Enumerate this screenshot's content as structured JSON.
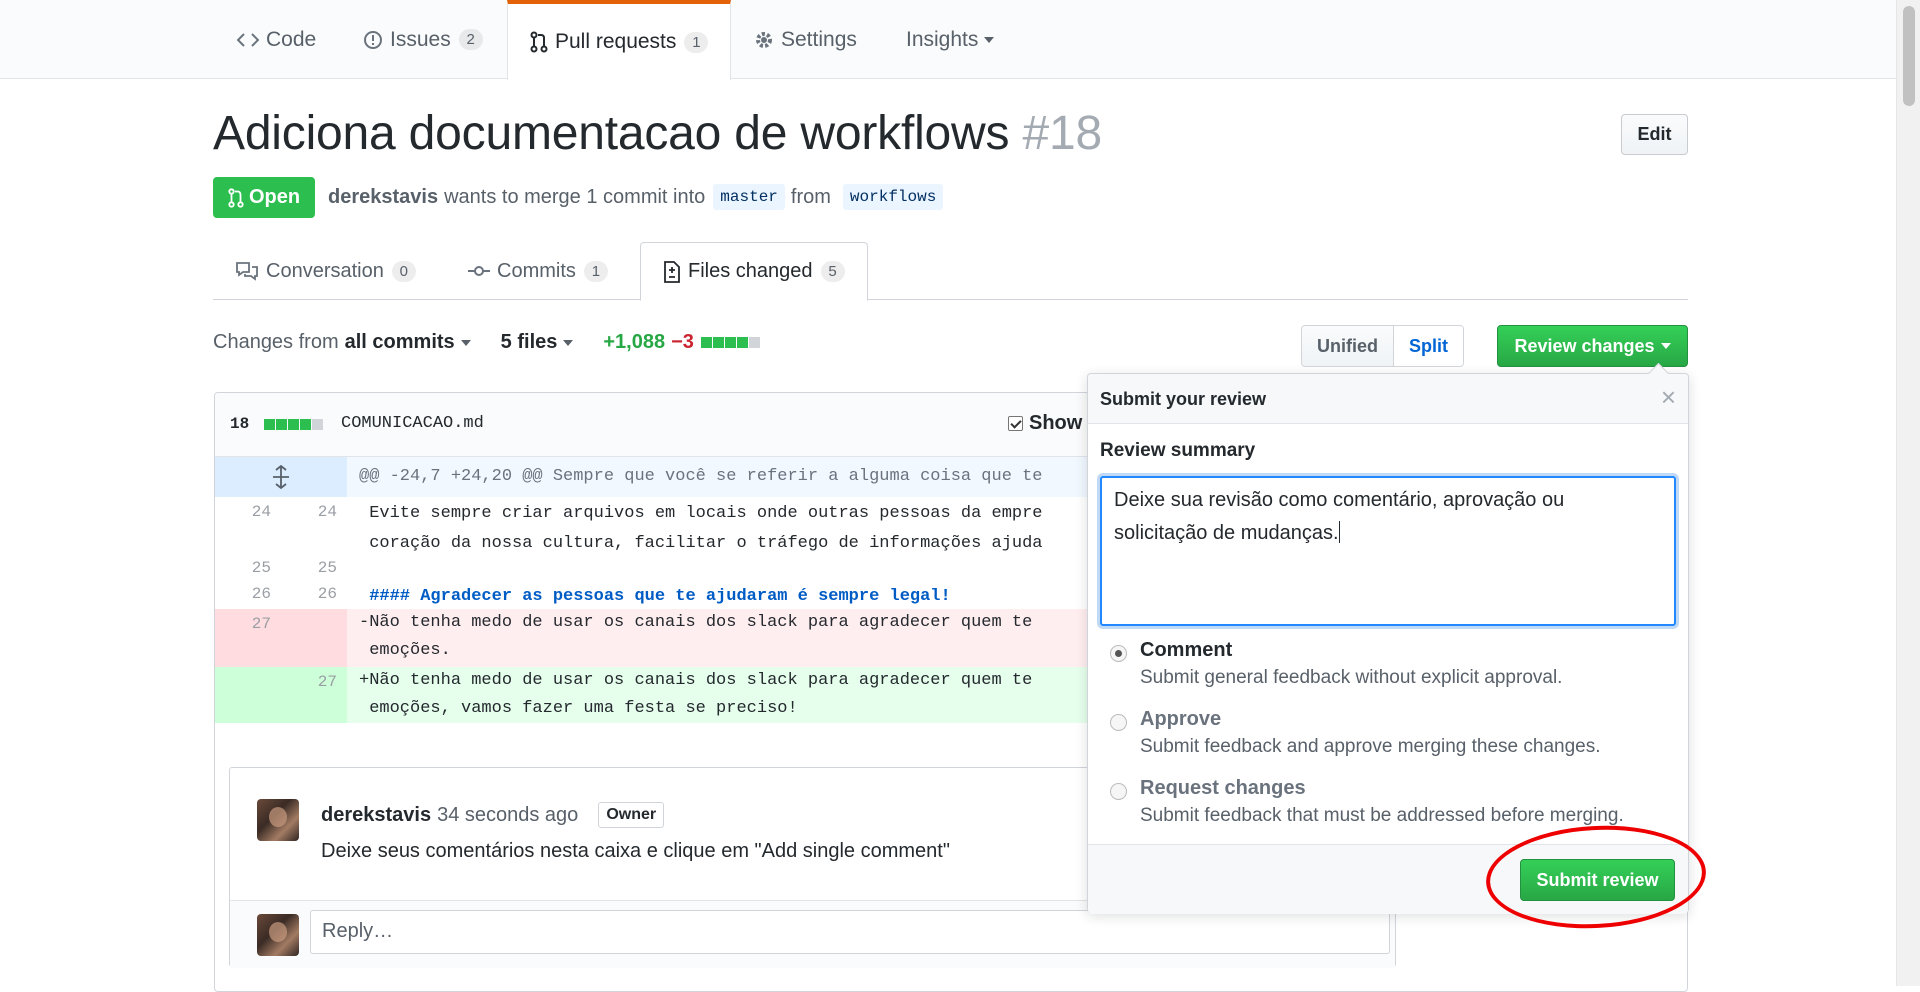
{
  "repo_nav": {
    "tabs": [
      {
        "label": "Code",
        "icon": "code-icon"
      },
      {
        "label": "Issues",
        "icon": "issue-icon",
        "count": "2"
      },
      {
        "label": "Pull requests",
        "icon": "pull-request-icon",
        "count": "1"
      },
      {
        "label": "Settings",
        "icon": "gear-icon"
      },
      {
        "label": "Insights",
        "icon": "chevron-down-icon"
      }
    ]
  },
  "pr": {
    "title": "Adiciona documentacao de workflows",
    "number": "#18",
    "edit_label": "Edit",
    "state": "Open",
    "author": "derekstavis",
    "merge_text": "wants to merge 1 commit into",
    "base_branch": "master",
    "from_text": "from",
    "head_branch": "workflows"
  },
  "pr_tabs": [
    {
      "label": "Conversation",
      "count": "0",
      "icon": "comment-discussion-icon"
    },
    {
      "label": "Commits",
      "count": "1",
      "icon": "commit-icon"
    },
    {
      "label": "Files changed",
      "count": "5",
      "icon": "file-diff-icon"
    }
  ],
  "toolbar": {
    "changes_prefix": "Changes from",
    "changes_value": "all commits",
    "files": "5 files",
    "additions": "+1,088",
    "deletions": "−3",
    "unified_label": "Unified",
    "split_label": "Split",
    "review_label": "Review changes"
  },
  "file": {
    "changes": "18",
    "name": "COMUNICACAO.md",
    "show_label": "Show",
    "hunk": "@@ -24,7 +24,20 @@ Sempre que você se referir a alguma coisa que te",
    "lines": [
      {
        "a": "24",
        "b": "24",
        "text": " Evite sempre criar arquivos em locais onde outras pessoas da empre"
      },
      {
        "a": "",
        "b": "",
        "text": " coração da nossa cultura, facilitar o tráfego de informações ajuda"
      },
      {
        "a": "25",
        "b": "25",
        "text": ""
      },
      {
        "a": "26",
        "b": "26",
        "text": " #### Agradecer as pessoas que te ajudaram é sempre legal!"
      },
      {
        "a": "27",
        "b": "",
        "text": "-Não tenha medo de usar os canais dos slack para agradecer quem te"
      },
      {
        "a": "",
        "b": "",
        "text": " emoções."
      },
      {
        "a": "",
        "b": "27",
        "text": "+Não tenha medo de usar os canais dos slack para agradecer quem te"
      },
      {
        "a": "",
        "b": "",
        "text": " emoções, vamos fazer uma festa se preciso!"
      }
    ]
  },
  "comment": {
    "author": "derekstavis",
    "time": "34 seconds ago",
    "badge": "Owner",
    "body": "Deixe seus comentários nesta caixa e clique em \"Add single comment\"",
    "reply_placeholder": "Reply…"
  },
  "review_popup": {
    "title": "Submit your review",
    "close": "×",
    "summary_label": "Review summary",
    "summary_text": "Deixe sua revisão como comentário, aprovação ou solicitação de mudanças.",
    "options": [
      {
        "title": "Comment",
        "desc": "Submit general feedback without explicit approval.",
        "selected": true
      },
      {
        "title": "Approve",
        "desc": "Submit feedback and approve merging these changes.",
        "selected": false
      },
      {
        "title": "Request changes",
        "desc": "Submit feedback that must be addressed before merging.",
        "selected": false
      }
    ],
    "submit_label": "Submit review"
  },
  "colors": {
    "accent_green": "#28a745",
    "tab_orange": "#e36209",
    "highlight_red": "#ee0000",
    "link_blue": "#0366d6"
  }
}
